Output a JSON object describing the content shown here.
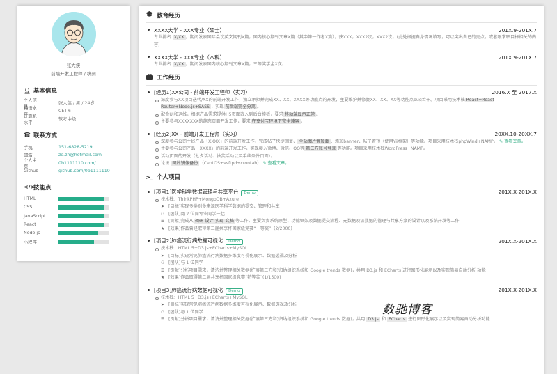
{
  "profile": {
    "name": "张大侠",
    "title": "前端开发工程师 / 杭州"
  },
  "basic": {
    "heading": "基本信息",
    "rows": [
      {
        "k": "个人信息",
        "v": "张大侠 / 男 / 24岁"
      },
      {
        "k": "英语水平",
        "v": "CET-6"
      },
      {
        "k": "计算机水平",
        "v": "软考中级"
      }
    ]
  },
  "contact": {
    "heading": "联系方式",
    "rows": [
      {
        "k": "手机",
        "v": "151-6828-5219"
      },
      {
        "k": "邮箱",
        "v": "ze.zh@hotmail.com"
      },
      {
        "k": "个人主页",
        "v": "0b1111110.com/"
      },
      {
        "k": "Github",
        "v": "github.com/0b1111110"
      }
    ]
  },
  "skills": {
    "heading": "技能点",
    "items": [
      {
        "name": "HTML",
        "level": 0.9
      },
      {
        "name": "CSS",
        "level": 0.9
      },
      {
        "name": "JavaScript",
        "level": 0.9
      },
      {
        "name": "React",
        "level": 0.9
      },
      {
        "name": "Node.js",
        "level": 0.78
      },
      {
        "name": "小程序",
        "level": 0.7
      }
    ]
  },
  "education": {
    "heading": "教育经历",
    "items": [
      {
        "school": "XXXX大学 - XXX专业（硕士）",
        "date": "201X.9-201X.7",
        "desc_a": "专业排名",
        "hl": "X/XX",
        "desc_b": "，期间发表国际会议英文期刊X篇，国内核心期刊文章X篇（其中第一作者X篇），获XXX，XXX2次，XXX2次。(此处根据自身情况填写，可以突出自己的亮点，或者跟求职目标相关的内容)"
      },
      {
        "school": "XXXX大学 - XXX专业（本科）",
        "date": "201X.9-201X.7",
        "desc_a": "专业排名",
        "hl": "X/XX",
        "desc_b": "，期间发表国内核心期刊文章X篇，三等奖学金X次。"
      }
    ]
  },
  "work": {
    "heading": "工作经历",
    "items": [
      {
        "title": "[经历1]XX公司 - 前端开发工程师（实习）",
        "date": "2016.X 至 2017.X",
        "l1a": "深度参与XX项目迭代/XX的前端开发工作，独立承担并完成XX、XX、XXXX等功能点的开发，主要维护并修复XX、XX、XX等功能点bug若干。项目采用技术栈",
        "l1hl": "React+React Router+Node.js+SASS",
        "l1b": "，实现",
        "l1hl2": "前后端完全分离",
        "l1c": "。",
        "l2a": "配合UI和运维，根据产品需求提供H5页面嵌入到后台模板，要求",
        "l2hl": "移动端显示正常",
        "l2b": "。",
        "l3a": "主要参与XXXXXXX的静态页面开发工作，要求",
        "l3hl": "在支付宝环境下完全兼容",
        "l3b": "。"
      },
      {
        "title": "[经历2]XX - 前端开发工程师（实习）",
        "date": "20XX.10-20XX.7",
        "l1a": "深度参与公司主线产品「XXXX」的前端开发工作，完成帖子快捷回复、",
        "l1hl": "全站图片懒加载",
        "l1b": "、添加banner、帖子置顶（使用Yii框架）等功能。项目采用技术栈phpWind+NAMP。",
        "l1link": "查看文章。",
        "l2a": "主要参与公司产品「XXXX」的前端开发工作，实现接入微博、微信、QQ等",
        "l2hl": "第三方账号登录",
        "l2b": "等功能。项目采用技术栈WordPress+NAMP。",
        "l3": "活动页面的开发（七夕活动、抽奖活动以及手续条件页面）。",
        "l4a": "论坛",
        "l4hl": "图片镜像备份",
        "l4b": "（CentOS+vsftpd+crontab）",
        "l4link": "查看文章。"
      }
    ]
  },
  "projects": {
    "heading": "个人项目",
    "items": [
      {
        "title": "[项目1]医学科学数据管理与共享平台",
        "badge": "Demo",
        "date": "201X.X-201X.X",
        "stack": "技术栈：ThinkPHP+MongoDB+Axure",
        "p1": "[目标]实现多类别多来源医学科学数据的提交、管理和共享",
        "p2": "[团队]两 2 位同专业同学一起",
        "p3a": "[贡献]完成从",
        "p3hl": "调研-设计-实现-文档",
        "p3b": "等工作，主要负责系统原型、功能框架及数据提交流程、元数据及该数据的管理与共享方案的设计以及系统开发等工作",
        "p4": "[效果]作品曾经取得第三届共享杯国家级竞赛“一等奖”（2/2000）"
      },
      {
        "title": "[项目2]肺癌流行病数据可视化",
        "badge": "Demo",
        "date": "201X.X-201X.X",
        "stack": "技术栈：HTML 5+D3.js+ECharts+MySQL",
        "p1": "[目标]实现常见肺癌流行病数据多维度可视化展示、数据透视及分析",
        "p2": "[团队]与 1 位同学",
        "p3": "[贡献]分析项目需求，清洗并整理相关数据(扩展第三方和)归纳组织系统和 Google trends 数据)，共用 D3.js 和 ECharts 进行图形化展示以及实现简易自动分析 功能",
        "p4": "[效果]作品取得第二届共享杯国家级竞赛“特等奖”(1/1500)"
      },
      {
        "title": "[项目3]肺癌流行病数据可视化",
        "badge": "Demo",
        "date": "201X.X-201X.X",
        "stack": "技术栈：HTML 5+D3.js+ECharts+MySQL",
        "p1": "[目标]实现常见肺癌流行病数据多维度可视化展示、数据透视及分析",
        "p2": "[团队]与 1 位同学",
        "p3a": "[贡献]分析项目需求，清洗并整理相关数据(扩展第三方和)归纳组织系统和 Google trends 数据)，共用",
        "p3hl": "D3.js",
        "p3b": "和",
        "p3hl2": "ECharts",
        "p3c": "进行图形化展示以及实现简易自动分析功能"
      }
    ]
  },
  "watermark": "数驰博客"
}
